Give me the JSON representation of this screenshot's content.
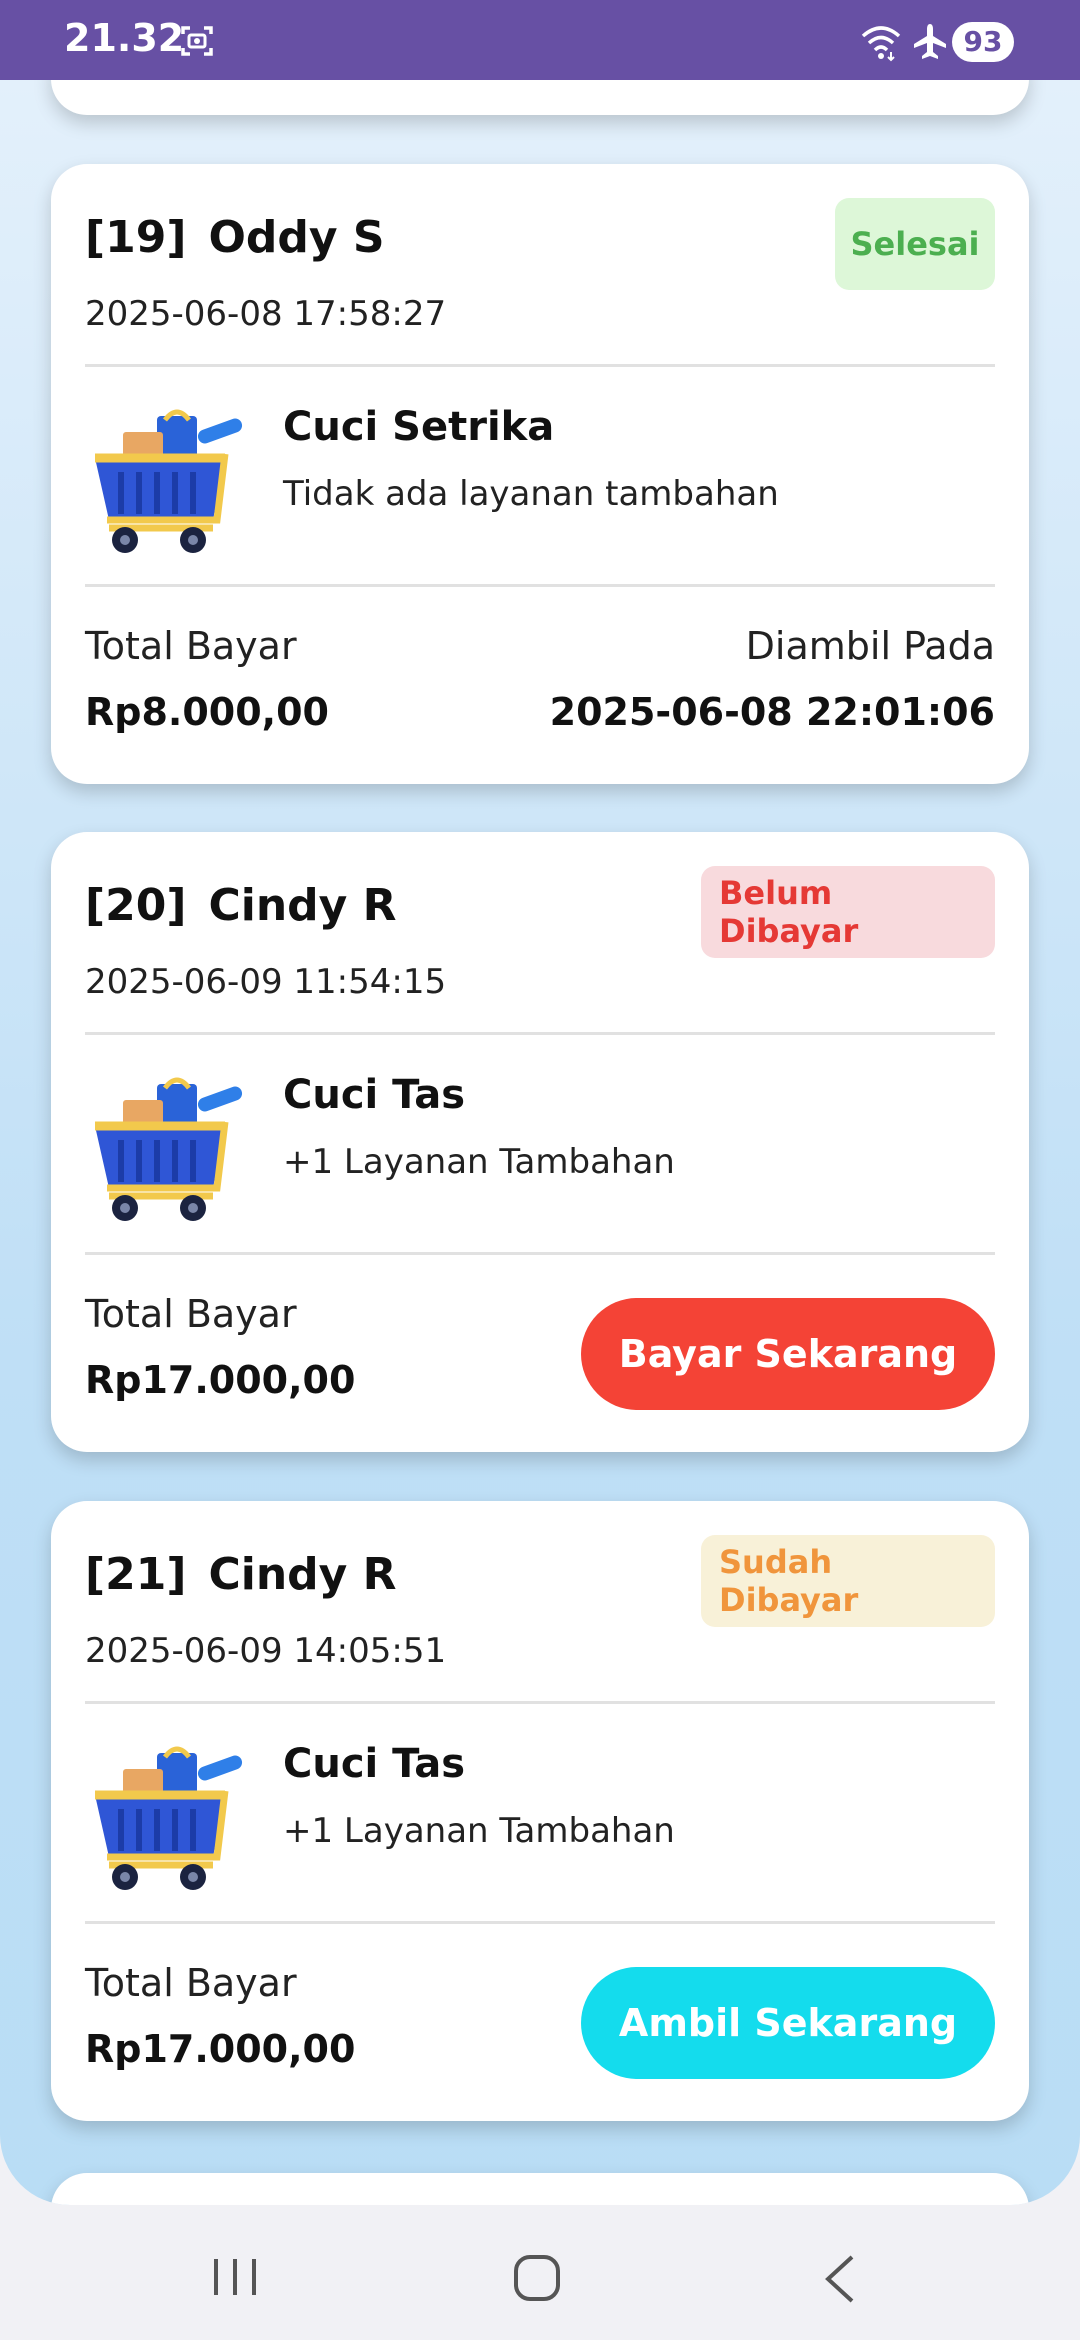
{
  "status_bar": {
    "time": "21.32",
    "battery": "93",
    "icons": [
      "screenshot-icon",
      "wifi-icon",
      "airplane-icon",
      "battery-icon"
    ]
  },
  "colors": {
    "status_bar": "#6750a4",
    "badge_done_bg": "#ddf7d8",
    "badge_done_text": "#4caf50",
    "badge_unpaid_bg": "#f8dadd",
    "badge_unpaid_text": "#e53935",
    "badge_paid_bg": "#f8f1d8",
    "badge_paid_text": "#f0953c",
    "pay_button": "#f44336",
    "pickup_button": "#14dced"
  },
  "orders": [
    {
      "id": "[19]",
      "customer": "Oddy S",
      "date": "2025-06-08 17:58:27",
      "status": "Selesai",
      "service": "Cuci Setrika",
      "extra": "Tidak ada layanan tambahan",
      "total_label": "Total Bayar",
      "total": "Rp8.000,00",
      "pickup_label": "Diambil Pada",
      "pickup_time": "2025-06-08 22:01:06"
    },
    {
      "id": "[20]",
      "customer": "Cindy R",
      "date": "2025-06-09 11:54:15",
      "status": "Belum Dibayar",
      "service": "Cuci Tas",
      "extra": "+1 Layanan Tambahan",
      "total_label": "Total Bayar",
      "total": "Rp17.000,00",
      "action": "Bayar Sekarang"
    },
    {
      "id": "[21]",
      "customer": "Cindy R",
      "date": "2025-06-09 14:05:51",
      "status": "Sudah Dibayar",
      "service": "Cuci Tas",
      "extra": "+1 Layanan Tambahan",
      "total_label": "Total Bayar",
      "total": "Rp17.000,00",
      "action": "Ambil Sekarang"
    }
  ],
  "nav": {
    "icons": [
      "recent-apps-icon",
      "home-icon",
      "back-icon"
    ]
  }
}
